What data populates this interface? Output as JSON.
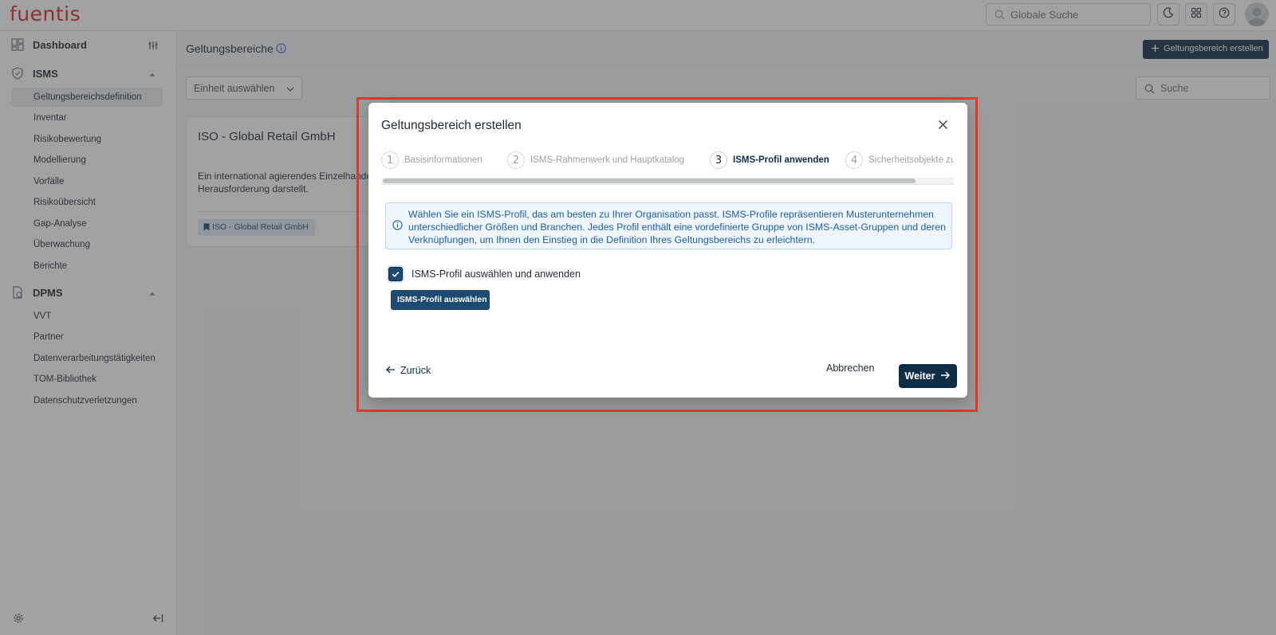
{
  "app": {
    "logo": "fuentis",
    "global_search_placeholder": "Globale Suche"
  },
  "sidebar": {
    "dashboard": "Dashboard",
    "isms": {
      "label": "ISMS",
      "items": [
        "Geltungsbereichsdefinition",
        "Inventar",
        "Risikobewertung",
        "Modellierung",
        "Vorfälle",
        "Risikoübersicht",
        "Gap-Analyse",
        "Überwachung",
        "Berichte"
      ],
      "active_index": 0
    },
    "dpms": {
      "label": "DPMS",
      "items": [
        "VVT",
        "Partner",
        "Datenverarbeitungstätigkeiten",
        "TOM-Bibliothek",
        "Datenschutzverletzungen"
      ]
    }
  },
  "page": {
    "title": "Geltungsbereiche",
    "create_button": "Geltungsbereich erstellen",
    "unit_select": "Einheit auswählen",
    "search_placeholder": "Suche",
    "card": {
      "title": "ISO - Global Retail GmbH",
      "description": "Ein international agierendes Einzelhandelsunternehmen, für das die Einhaltung der Compliance oft eine Herausforderung darstellt.",
      "tag": "ISO - Global Retail GmbH"
    }
  },
  "modal": {
    "title": "Geltungsbereich erstellen",
    "steps": [
      {
        "num": "1",
        "label": "Basisinformationen"
      },
      {
        "num": "2",
        "label": "ISMS-Rahmenwerk und Hauptkatalog"
      },
      {
        "num": "3",
        "label": "ISMS-Profil anwenden"
      },
      {
        "num": "4",
        "label": "Sicherheitsobjekte zuordnen"
      }
    ],
    "current_step": 3,
    "info_text": "Wählen Sie ein ISMS-Profil, das am besten zu Ihrer Organisation passt. ISMS-Profile repräsentieren Musterunternehmen unterschiedlicher Größen und Branchen. Jedes Profil enthält eine vordefinierte Gruppe von ISMS-Asset-Gruppen und deren Verknüpfungen, um Ihnen den Einstieg in die Definition Ihres Geltungsbereichs zu erleichtern.",
    "checkbox_label": "ISMS-Profil auswählen und anwenden",
    "checkbox_checked": true,
    "profile_button": "ISMS-Profil auswählen",
    "back": "Zurück",
    "cancel": "Abbrechen",
    "next": "Weiter"
  },
  "colors": {
    "brand_red": "#d9262e",
    "primary_navy": "#0e2d47",
    "info_blue": "#1d5ea8",
    "highlight": "#e8372a"
  }
}
